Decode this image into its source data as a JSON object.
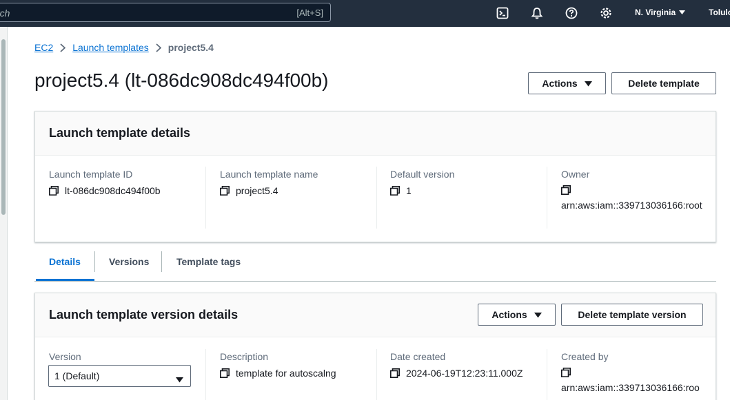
{
  "topbar": {
    "search_text": "rch",
    "search_shortcut": "[Alt+S]",
    "region": "N. Virginia",
    "user": "Tolulo",
    "icons": [
      "cloudshell-icon",
      "notifications-icon",
      "help-icon",
      "settings-icon"
    ]
  },
  "breadcrumb": {
    "items": [
      "EC2",
      "Launch templates"
    ],
    "current": "project5.4"
  },
  "page": {
    "title": "project5.4 (lt-086dc908dc494f00b)",
    "actions_label": "Actions",
    "delete_label": "Delete template"
  },
  "details_card": {
    "title": "Launch template details",
    "fields": [
      {
        "label": "Launch template ID",
        "value": "lt-086dc908dc494f00b"
      },
      {
        "label": "Launch template name",
        "value": "project5.4"
      },
      {
        "label": "Default version",
        "value": "1"
      },
      {
        "label": "Owner",
        "value": "arn:aws:iam::339713036166:root"
      }
    ]
  },
  "tabs": [
    "Details",
    "Versions",
    "Template tags"
  ],
  "version_card": {
    "title": "Launch template version details",
    "actions_label": "Actions",
    "delete_label": "Delete template version",
    "version_label": "Version",
    "version_value": "1 (Default)",
    "fields": [
      {
        "label": "Description",
        "value": "template for autoscalng"
      },
      {
        "label": "Date created",
        "value": "2024-06-19T12:23:11.000Z"
      },
      {
        "label": "Created by",
        "value": "arn:aws:iam::339713036166:roo"
      }
    ]
  },
  "colors": {
    "header_bg": "#232f3e",
    "link": "#0972d3",
    "text": "#16191f",
    "muted": "#5f6b7a"
  }
}
